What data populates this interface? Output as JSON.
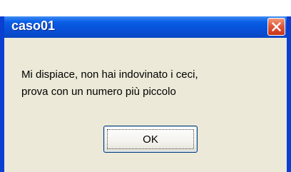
{
  "window": {
    "title": "caso01"
  },
  "message": {
    "line1": "Mi dispiace, non hai indovinato i ceci,",
    "line2": "prova con un numero più piccolo"
  },
  "buttons": {
    "ok_label": "OK"
  },
  "colors": {
    "titlebar": "#0a5fe6",
    "dialog_bg": "#ece9d8",
    "close_button": "#e0583a"
  },
  "icons": [
    "close-icon"
  ]
}
